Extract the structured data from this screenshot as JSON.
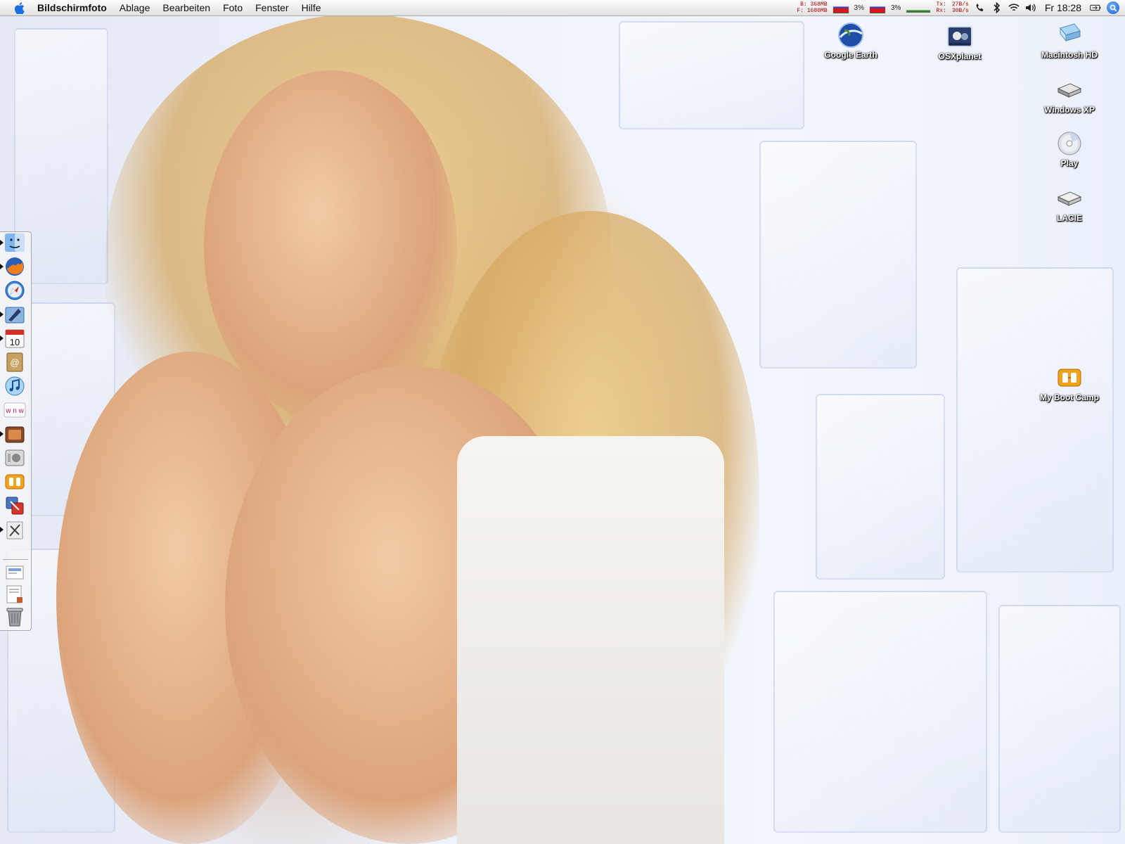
{
  "menubar": {
    "app_name": "Bildschirmfoto",
    "items": [
      "Ablage",
      "Bearbeiten",
      "Foto",
      "Fenster",
      "Hilfe"
    ],
    "status": {
      "memory_b": "B: 368MB",
      "memory_f": "F: 1680MB",
      "cpu1": "3%",
      "cpu2": "3%",
      "net_tx_label": "Tx:",
      "net_rx_label": "Rx:",
      "net_tx": "27B/s",
      "net_rx": "30B/s",
      "clock": "Fr 18:28"
    }
  },
  "desktop_icons": [
    {
      "label": "Google Earth",
      "icon": "google-earth-icon"
    },
    {
      "label": "OSXplanet",
      "icon": "osxplanet-icon"
    },
    {
      "label": "Macintosh HD",
      "icon": "hard-drive-icon"
    },
    {
      "label": "Windows XP",
      "icon": "windows-drive-icon"
    },
    {
      "label": "Play",
      "icon": "cd-disc-icon"
    },
    {
      "label": "LACIE",
      "icon": "external-drive-icon"
    },
    {
      "label": "My Boot Camp",
      "icon": "boot-camp-icon"
    }
  ],
  "dock_items": [
    "finder-icon",
    "firefox-icon",
    "safari-icon",
    "mail-icon",
    "ical-icon",
    "address-book-icon",
    "itunes-icon",
    "www-icon",
    "media-app-icon",
    "system-preferences-icon",
    "boot-camp-icon",
    "transfer-app-icon",
    "utilities-icon",
    "document-stack-icon",
    "document-stack-2-icon",
    "trash-icon"
  ],
  "colors": {
    "menubar_bg": "#e9e9e9",
    "label_text": "#ffffff",
    "accent_blue": "#1d5fd0"
  }
}
